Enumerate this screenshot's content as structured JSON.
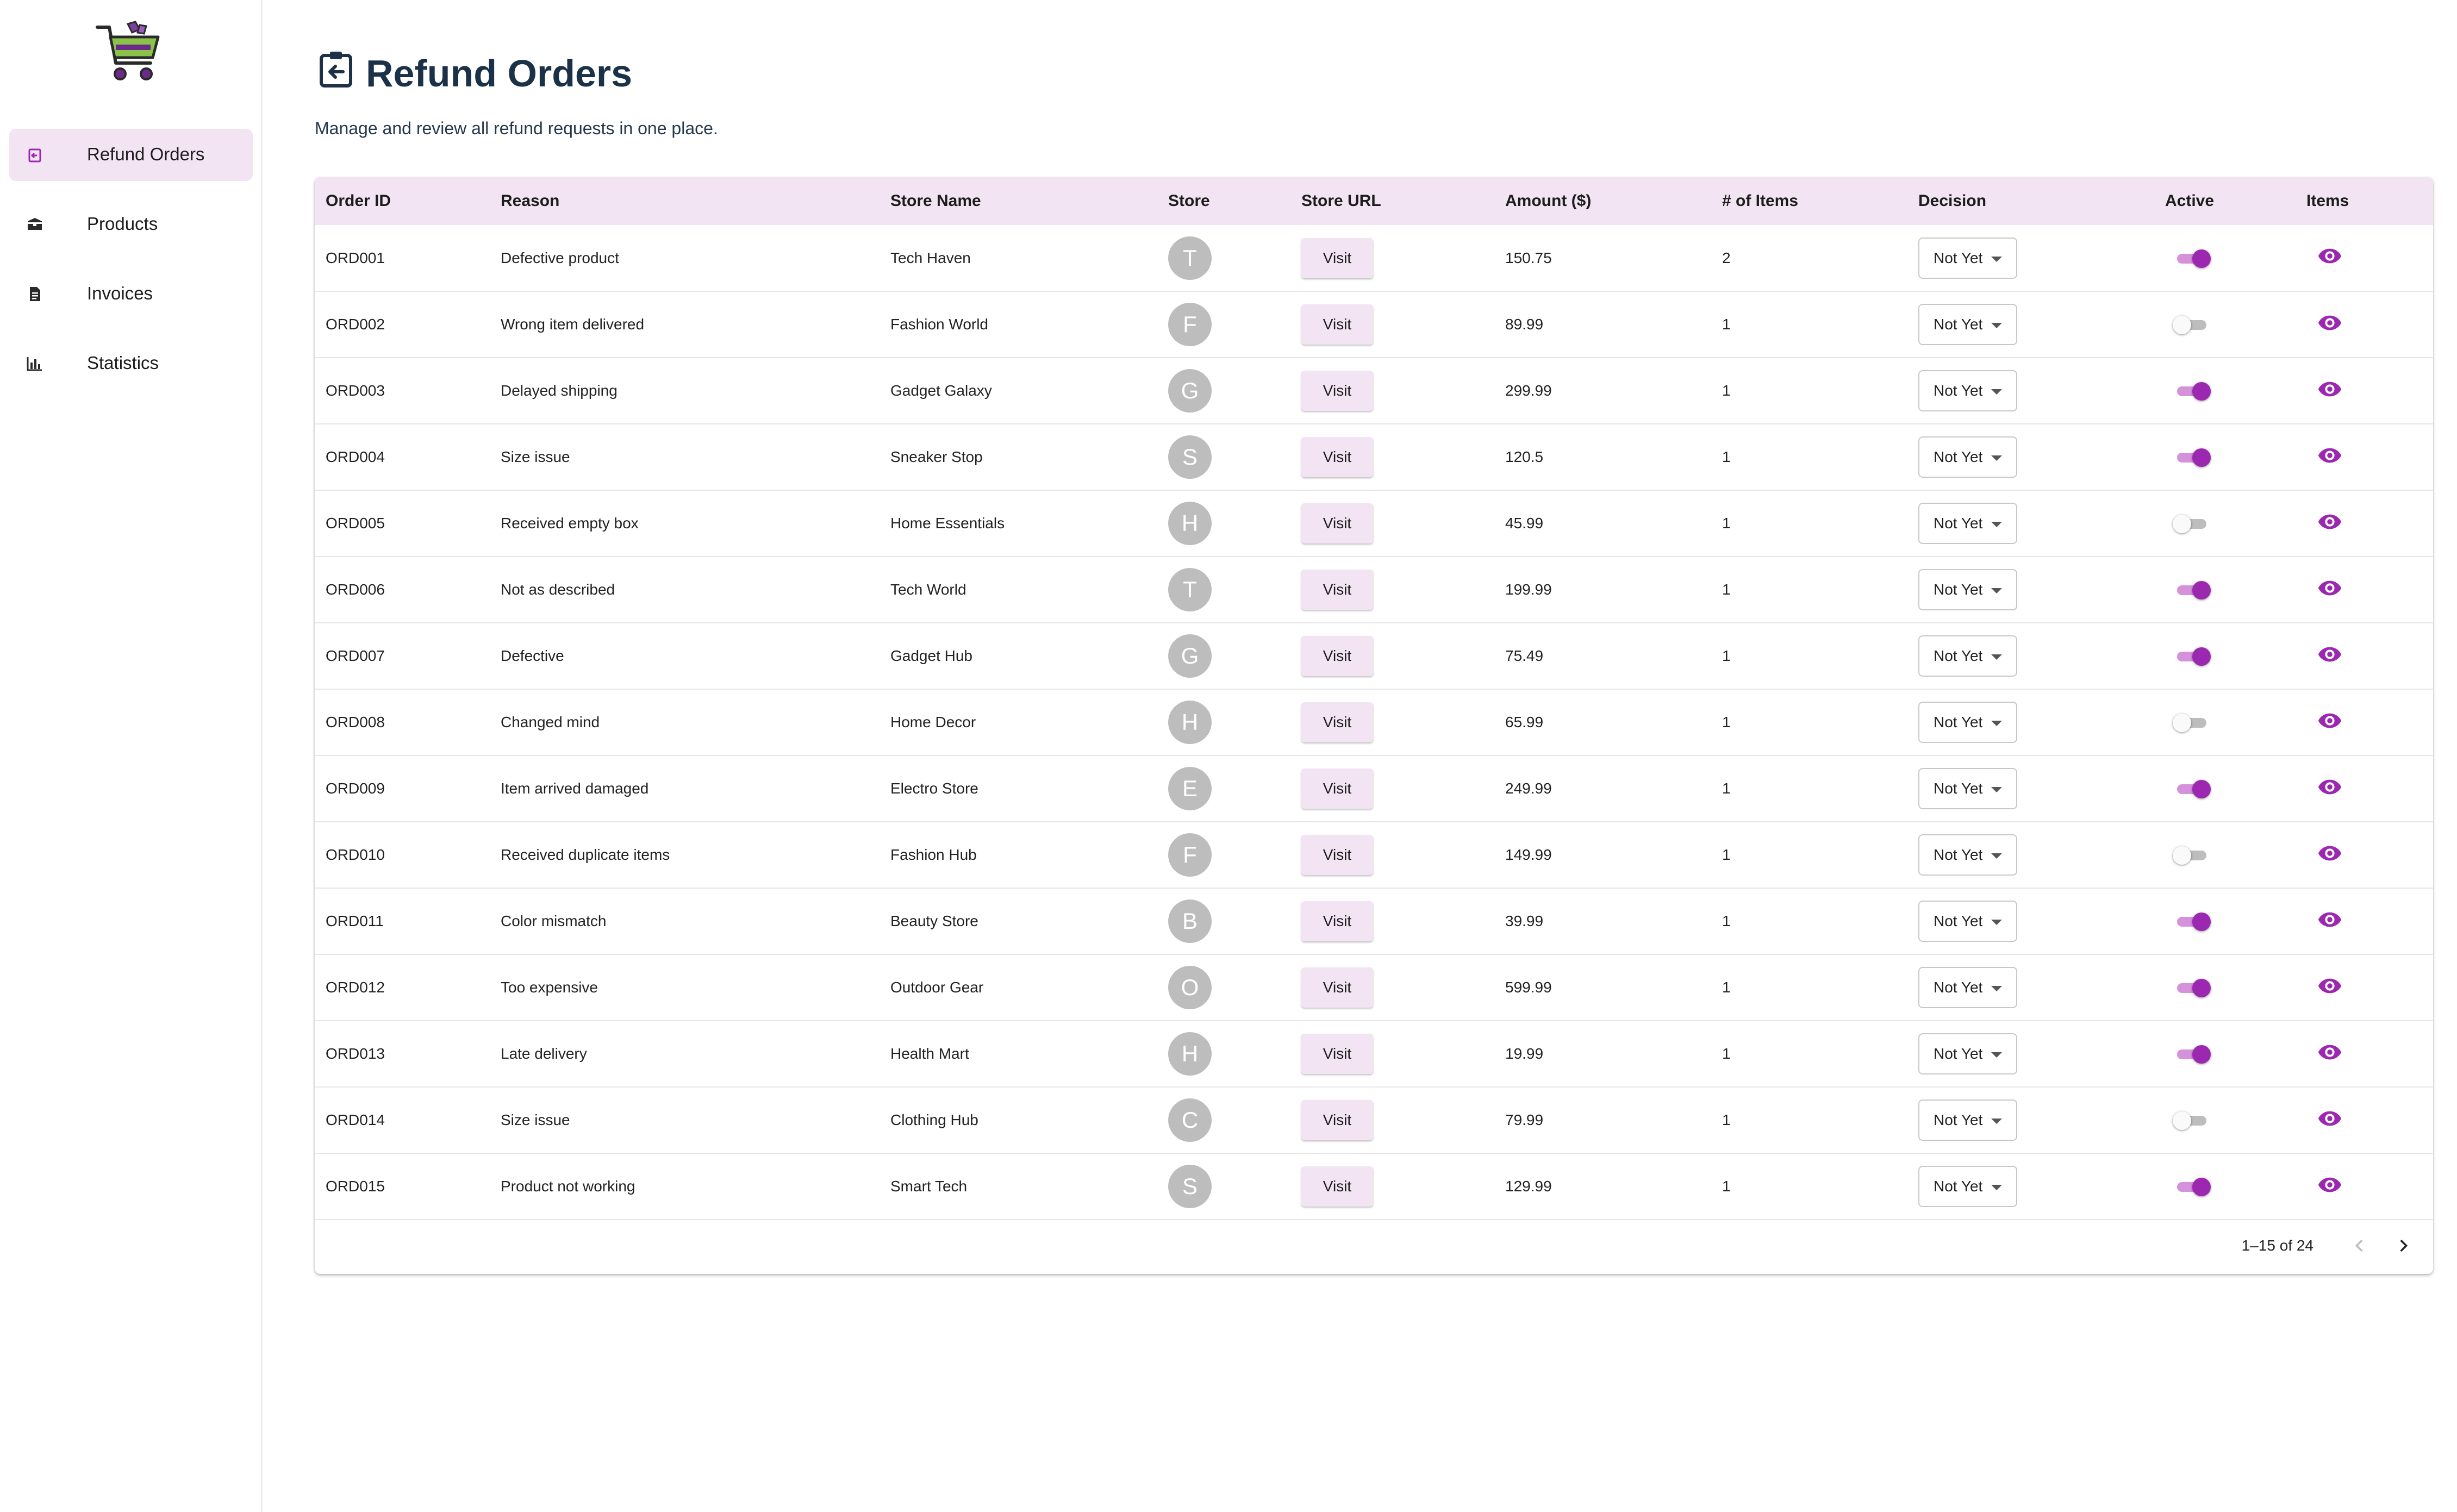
{
  "sidebar": {
    "items": [
      {
        "label": "Refund Orders",
        "icon": "refund-icon",
        "active": true
      },
      {
        "label": "Products",
        "icon": "box-icon",
        "active": false
      },
      {
        "label": "Invoices",
        "icon": "document-icon",
        "active": false
      },
      {
        "label": "Statistics",
        "icon": "bar-chart-icon",
        "active": false
      }
    ]
  },
  "header": {
    "title": "Refund Orders",
    "subtitle": "Manage and review all refund requests in one place."
  },
  "table": {
    "columns": [
      "Order ID",
      "Reason",
      "Store Name",
      "Store",
      "Store URL",
      "Amount ($)",
      "# of Items",
      "Decision",
      "Active",
      "Items"
    ],
    "visit_label": "Visit",
    "rows": [
      {
        "order_id": "ORD001",
        "reason": "Defective product",
        "store_name": "Tech Haven",
        "store_initial": "T",
        "amount": "150.75",
        "items": "2",
        "decision": "Not Yet",
        "active": true
      },
      {
        "order_id": "ORD002",
        "reason": "Wrong item delivered",
        "store_name": "Fashion World",
        "store_initial": "F",
        "amount": "89.99",
        "items": "1",
        "decision": "Not Yet",
        "active": false
      },
      {
        "order_id": "ORD003",
        "reason": "Delayed shipping",
        "store_name": "Gadget Galaxy",
        "store_initial": "G",
        "amount": "299.99",
        "items": "1",
        "decision": "Not Yet",
        "active": true
      },
      {
        "order_id": "ORD004",
        "reason": "Size issue",
        "store_name": "Sneaker Stop",
        "store_initial": "S",
        "amount": "120.5",
        "items": "1",
        "decision": "Not Yet",
        "active": true
      },
      {
        "order_id": "ORD005",
        "reason": "Received empty box",
        "store_name": "Home Essentials",
        "store_initial": "H",
        "amount": "45.99",
        "items": "1",
        "decision": "Not Yet",
        "active": false
      },
      {
        "order_id": "ORD006",
        "reason": "Not as described",
        "store_name": "Tech World",
        "store_initial": "T",
        "amount": "199.99",
        "items": "1",
        "decision": "Not Yet",
        "active": true
      },
      {
        "order_id": "ORD007",
        "reason": "Defective",
        "store_name": "Gadget Hub",
        "store_initial": "G",
        "amount": "75.49",
        "items": "1",
        "decision": "Not Yet",
        "active": true
      },
      {
        "order_id": "ORD008",
        "reason": "Changed mind",
        "store_name": "Home Decor",
        "store_initial": "H",
        "amount": "65.99",
        "items": "1",
        "decision": "Not Yet",
        "active": false
      },
      {
        "order_id": "ORD009",
        "reason": "Item arrived damaged",
        "store_name": "Electro Store",
        "store_initial": "E",
        "amount": "249.99",
        "items": "1",
        "decision": "Not Yet",
        "active": true
      },
      {
        "order_id": "ORD010",
        "reason": "Received duplicate items",
        "store_name": "Fashion Hub",
        "store_initial": "F",
        "amount": "149.99",
        "items": "1",
        "decision": "Not Yet",
        "active": false
      },
      {
        "order_id": "ORD011",
        "reason": "Color mismatch",
        "store_name": "Beauty Store",
        "store_initial": "B",
        "amount": "39.99",
        "items": "1",
        "decision": "Not Yet",
        "active": true
      },
      {
        "order_id": "ORD012",
        "reason": "Too expensive",
        "store_name": "Outdoor Gear",
        "store_initial": "O",
        "amount": "599.99",
        "items": "1",
        "decision": "Not Yet",
        "active": true
      },
      {
        "order_id": "ORD013",
        "reason": "Late delivery",
        "store_name": "Health Mart",
        "store_initial": "H",
        "amount": "19.99",
        "items": "1",
        "decision": "Not Yet",
        "active": true
      },
      {
        "order_id": "ORD014",
        "reason": "Size issue",
        "store_name": "Clothing Hub",
        "store_initial": "C",
        "amount": "79.99",
        "items": "1",
        "decision": "Not Yet",
        "active": false
      },
      {
        "order_id": "ORD015",
        "reason": "Product not working",
        "store_name": "Smart Tech",
        "store_initial": "S",
        "amount": "129.99",
        "items": "1",
        "decision": "Not Yet",
        "active": true
      }
    ]
  },
  "pagination": {
    "range": "1–15 of 24"
  },
  "colors": {
    "accent": "#9c27b0",
    "accent_light": "#f3e4f4",
    "title": "#1b3147",
    "avatar": "#bdbdbd"
  }
}
